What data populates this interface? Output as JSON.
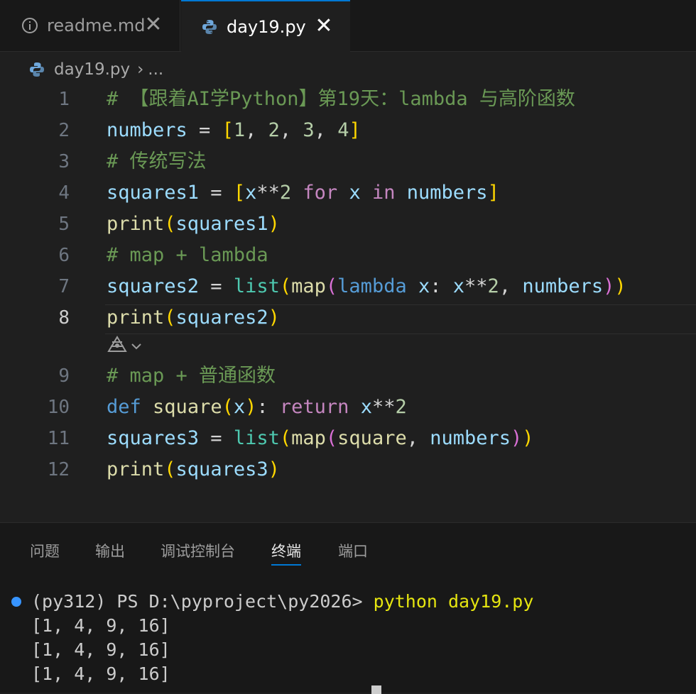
{
  "tabs": [
    {
      "label": "readme.md",
      "icon": "info-icon",
      "close": "✕",
      "active": false
    },
    {
      "label": "day19.py",
      "icon": "python-icon",
      "close": "✕",
      "active": true
    }
  ],
  "breadcrumb": {
    "file": "day19.py",
    "separator": "›",
    "ellipsis": "..."
  },
  "editor": {
    "current_line": 8,
    "line_numbers": [
      "1",
      "2",
      "3",
      "4",
      "5",
      "6",
      "7",
      "8",
      "9",
      "10",
      "11",
      "12"
    ],
    "lines": [
      "# 【跟着AI学Python】第19天：lambda 与高阶函数",
      "numbers = [1, 2, 3, 4]",
      "# 传统写法",
      "squares1 = [x**2 for x in numbers]",
      "print(squares1)",
      "# map + lambda",
      "squares2 = list(map(lambda x: x**2, numbers))",
      "print(squares2)",
      "# map + 普通函数",
      "def square(x): return x**2",
      "squares3 = list(map(square, numbers))",
      "print(squares3)"
    ],
    "hint_icon": "copilot-icon",
    "hint_chevron": "⌄"
  },
  "panel": {
    "tabs": [
      {
        "label": "问题",
        "active": false
      },
      {
        "label": "输出",
        "active": false
      },
      {
        "label": "调试控制台",
        "active": false
      },
      {
        "label": "终端",
        "active": true
      },
      {
        "label": "端口",
        "active": false
      }
    ],
    "terminal": {
      "prompt": "(py312) PS D:\\pyproject\\py2026> ",
      "command": "python day19.py",
      "outputs": [
        "[1, 4, 9, 16]",
        "[1, 4, 9, 16]",
        "[1, 4, 9, 16]"
      ]
    }
  },
  "colors": {
    "accent": "#0078d4",
    "comment": "#6a9955",
    "variable": "#9cdcfe",
    "function": "#dcdcaa",
    "number": "#b5cea8",
    "keyword": "#c586c0"
  }
}
